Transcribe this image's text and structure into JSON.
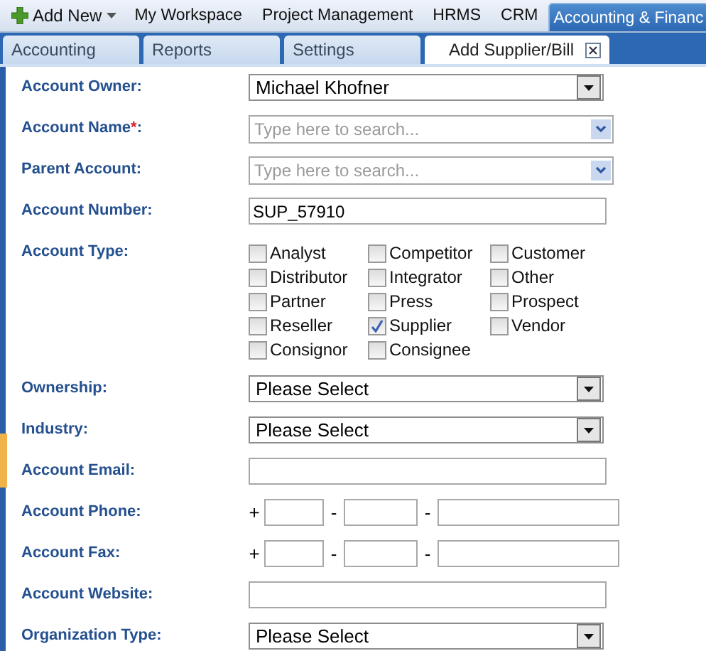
{
  "top_nav": {
    "add_new": "Add New",
    "items": [
      {
        "label": "My Workspace",
        "selected": false
      },
      {
        "label": "Project Management",
        "selected": false
      },
      {
        "label": "HRMS",
        "selected": false
      },
      {
        "label": "CRM",
        "selected": false
      },
      {
        "label": "Accounting & Financ",
        "selected": true
      }
    ]
  },
  "tabs": [
    {
      "label": "Accounting",
      "selected": false,
      "closable": false
    },
    {
      "label": "Reports",
      "selected": false,
      "closable": false
    },
    {
      "label": "Settings",
      "selected": false,
      "closable": false
    },
    {
      "label": "Add Supplier/Bill",
      "selected": true,
      "closable": true
    }
  ],
  "form": [
    {
      "kind": "select",
      "label": "Account Owner:",
      "value": "Michael Khofner"
    },
    {
      "kind": "search",
      "label": "Account Name",
      "required_mark": "*",
      "label_end": ":",
      "placeholder": "Type here to search..."
    },
    {
      "kind": "search",
      "label": "Parent Account:",
      "placeholder": "Type here to search..."
    },
    {
      "kind": "text",
      "label": "Account Number:",
      "value": "SUP_57910"
    },
    {
      "kind": "checkboxes",
      "label": "Account Type:",
      "options": [
        {
          "label": "Analyst",
          "checked": false
        },
        {
          "label": "Competitor",
          "checked": false
        },
        {
          "label": "Customer",
          "checked": false
        },
        {
          "label": "Distributor",
          "checked": false
        },
        {
          "label": "Integrator",
          "checked": false
        },
        {
          "label": "Other",
          "checked": false
        },
        {
          "label": "Partner",
          "checked": false
        },
        {
          "label": "Press",
          "checked": false
        },
        {
          "label": "Prospect",
          "checked": false
        },
        {
          "label": "Reseller",
          "checked": false
        },
        {
          "label": "Supplier",
          "checked": true
        },
        {
          "label": "Vendor",
          "checked": false
        },
        {
          "label": "Consignor",
          "checked": false
        },
        {
          "label": "Consignee",
          "checked": false
        }
      ]
    },
    {
      "kind": "select",
      "label": "Ownership:",
      "value": "Please Select"
    },
    {
      "kind": "select",
      "label": "Industry:",
      "value": "Please Select"
    },
    {
      "kind": "text",
      "label": "Account Email:"
    },
    {
      "kind": "phone",
      "label": "Account Phone:",
      "separators": [
        "+",
        "-",
        "-"
      ]
    },
    {
      "kind": "phone",
      "label": "Account Fax:",
      "separators": [
        "+",
        "-",
        "-"
      ]
    },
    {
      "kind": "text",
      "label": "Account Website:"
    },
    {
      "kind": "select",
      "label": "Organization Type:",
      "value": "Please Select"
    }
  ]
}
